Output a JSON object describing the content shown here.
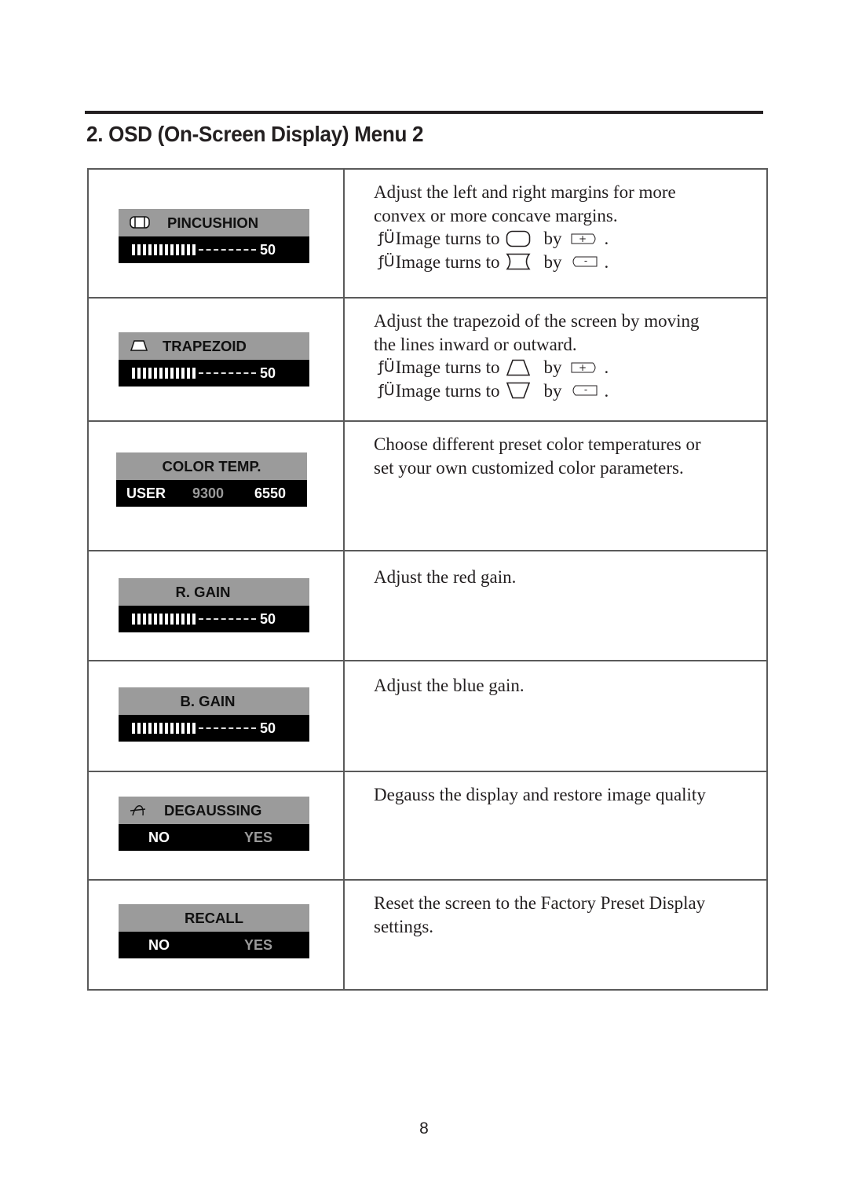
{
  "heading": "2. OSD (On-Screen Display) Menu 2",
  "page_number": "8",
  "rows": [
    {
      "osd": {
        "title": "PINCUSHION",
        "icon": "pincushion-icon",
        "type": "slider",
        "value": "50",
        "fill_fraction": 0.5
      },
      "desc": [
        "Adjust the left and right margins for more",
        "convex or more concave margins."
      ],
      "bullets": [
        {
          "prefix": "ƒÜ",
          "text": "Image turns to",
          "shape": "convex-rectangle-icon",
          "by": "by",
          "button": "plus-button-icon",
          "end": "."
        },
        {
          "prefix": "ƒÜ",
          "text": "Image turns to",
          "shape": "concave-rectangle-icon",
          "by": "by",
          "button": "minus-button-icon",
          "end": "."
        }
      ]
    },
    {
      "osd": {
        "title": "TRAPEZOID",
        "icon": "trapezoid-icon",
        "type": "slider",
        "value": "50",
        "fill_fraction": 0.5
      },
      "desc": [
        "Adjust the trapezoid of the screen by moving",
        "the lines inward or outward."
      ],
      "bullets": [
        {
          "prefix": "ƒÜ",
          "text": "Image turns to",
          "shape": "trapezoid-up-icon",
          "by": "by",
          "button": "plus-button-icon",
          "end": "."
        },
        {
          "prefix": "ƒÜ",
          "text": "Image turns to",
          "shape": "trapezoid-down-icon",
          "by": "by",
          "button": "minus-button-icon",
          "end": "."
        }
      ]
    },
    {
      "osd": {
        "title": "COLOR TEMP.",
        "type": "options",
        "options": [
          "USER",
          "9300",
          "6550"
        ],
        "dim_option": "9300"
      },
      "desc": [
        "Choose different preset color temperatures or",
        "set your own customized color parameters."
      ]
    },
    {
      "osd": {
        "title": "R. GAIN",
        "type": "slider",
        "value": "50",
        "fill_fraction": 0.5
      },
      "desc": [
        "Adjust the red gain."
      ]
    },
    {
      "osd": {
        "title": "B. GAIN",
        "type": "slider",
        "value": "50",
        "fill_fraction": 0.5
      },
      "desc": [
        "Adjust the blue gain."
      ]
    },
    {
      "osd": {
        "title": "DEGAUSSING",
        "icon": "degauss-icon",
        "type": "yesno",
        "options": [
          "NO",
          "YES"
        ]
      },
      "desc": [
        "Degauss the display and restore image quality"
      ]
    },
    {
      "osd": {
        "title": "RECALL",
        "type": "yesno",
        "options": [
          "NO",
          "YES"
        ]
      },
      "desc": [
        "Reset the screen to the Factory Preset Display",
        "settings."
      ]
    }
  ]
}
